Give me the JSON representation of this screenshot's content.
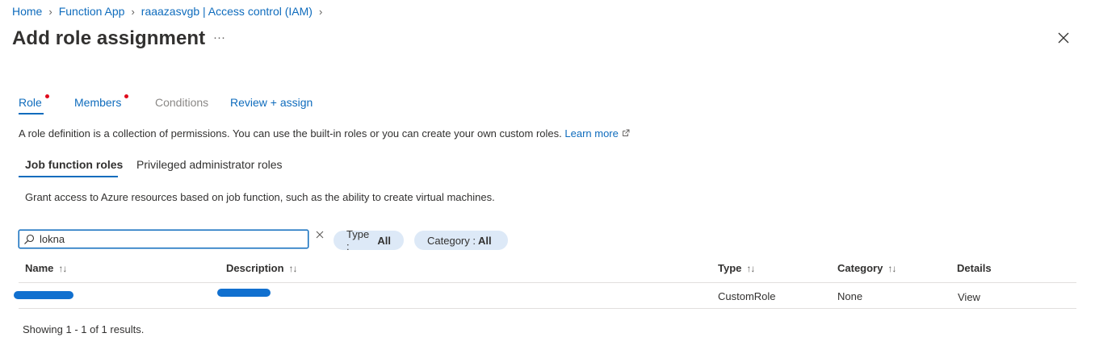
{
  "breadcrumb": {
    "items": [
      "Home",
      "Function App",
      "raaazasvgb | Access control (IAM)"
    ]
  },
  "header": {
    "title": "Add role assignment",
    "more_label": "···",
    "close_label": "×"
  },
  "tabs": [
    {
      "label": "Role",
      "required": true,
      "state": "active"
    },
    {
      "label": "Members",
      "required": true,
      "state": "link"
    },
    {
      "label": "Conditions",
      "required": false,
      "state": "disabled"
    },
    {
      "label": "Review + assign",
      "required": false,
      "state": "link"
    }
  ],
  "role_description": {
    "text": "A role definition is a collection of permissions. You can use the built-in roles or you can create your own custom roles.",
    "learn_more": "Learn more"
  },
  "subtabs": [
    {
      "label": "Job function roles",
      "active": true
    },
    {
      "label": "Privileged administrator roles",
      "active": false
    }
  ],
  "job_description": "Grant access to Azure resources based on job function, such as the ability to create virtual machines.",
  "search": {
    "value": "lokna"
  },
  "filters": {
    "type": {
      "label": "Type :",
      "value": "All"
    },
    "category": {
      "label": "Category :",
      "value": "All"
    }
  },
  "table": {
    "columns": [
      "Name",
      "Description",
      "Type",
      "Category",
      "Details"
    ],
    "sort_glyph": "↑↓",
    "rows": [
      {
        "name": "",
        "description": "",
        "type": "CustomRole",
        "category": "None",
        "details": "View"
      }
    ]
  },
  "results_text": "Showing 1 - 1 of 1 results.",
  "colors": {
    "accent": "#0f6cbd",
    "required_dot": "#e00b1c",
    "pill_bg": "#dde9f7",
    "redaction": "#1170cf"
  }
}
